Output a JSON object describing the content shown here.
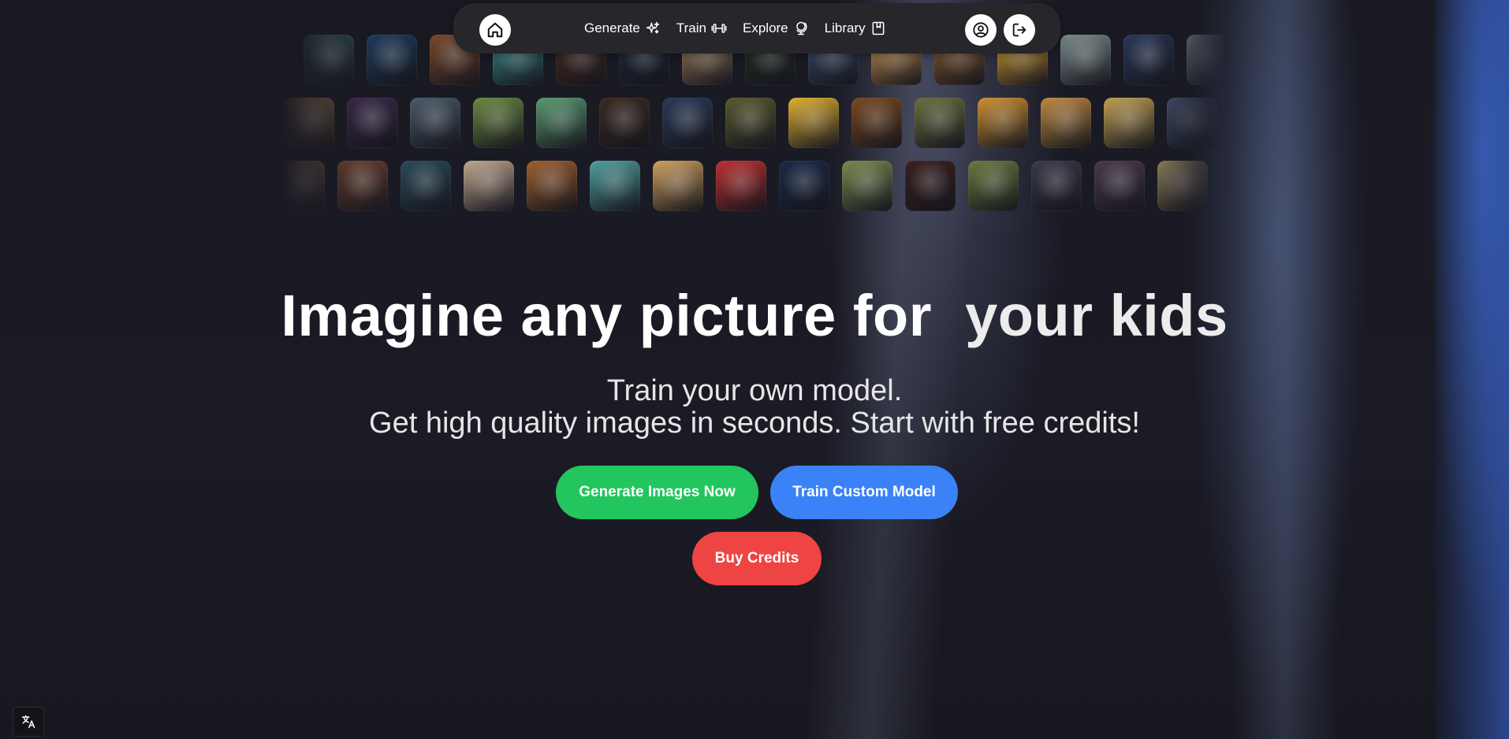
{
  "nav": {
    "items": [
      {
        "label": "Generate",
        "icon": "sparkles-icon"
      },
      {
        "label": "Train",
        "icon": "dumbbell-icon"
      },
      {
        "label": "Explore",
        "icon": "globe-icon"
      },
      {
        "label": "Library",
        "icon": "book-icon"
      }
    ],
    "home_icon": "home-icon",
    "account_icon": "user-circle-icon",
    "logout_icon": "logout-icon"
  },
  "hero": {
    "title_main": "Imagine any picture for",
    "title_accent": "your kids",
    "subtitle_line1": "Train your own model.",
    "subtitle_line2": "Get high quality images in seconds. Start with free credits!"
  },
  "buttons": {
    "generate": "Generate Images Now",
    "train": "Train Custom Model",
    "buy": "Buy Credits"
  },
  "colors": {
    "generate": "#22c55e",
    "train": "#3b82f6",
    "buy": "#ef4444",
    "nav_bg": "#26262b",
    "page_bg": "#1a1a24"
  },
  "gallery": {
    "rows": [
      [
        "#2f4a4a",
        "#1f3b5c",
        "#7a4a2a",
        "#3a8a8a",
        "#4a2a22",
        "#1e2a3a",
        "#9c7a5a",
        "#243024",
        "#3a4a6a",
        "#c89050",
        "#8a5a30",
        "#d8a030",
        "#7a8a8a",
        "#2a3a5a",
        "#8a9aa0"
      ],
      [
        "#7a6040",
        "#3a2a4a",
        "#4a5a6a",
        "#6a8a40",
        "#5a9a70",
        "#3a2a22",
        "#2a3a5a",
        "#5a5a30",
        "#e0b030",
        "#7a4a22",
        "#6a7040",
        "#d09030",
        "#c08a40",
        "#c0a050",
        "#4a5a7a"
      ],
      [
        "#6a5040",
        "#6a4030",
        "#2a4a5a",
        "#c0a890",
        "#a06030",
        "#50a0a0",
        "#d0a060",
        "#c03030",
        "#1a2a4a",
        "#7a8a50",
        "#3a2020",
        "#6a7a40",
        "#3a3a4a",
        "#4a3a4a",
        "#9a8a60"
      ]
    ]
  },
  "language_icon": "translate-icon"
}
